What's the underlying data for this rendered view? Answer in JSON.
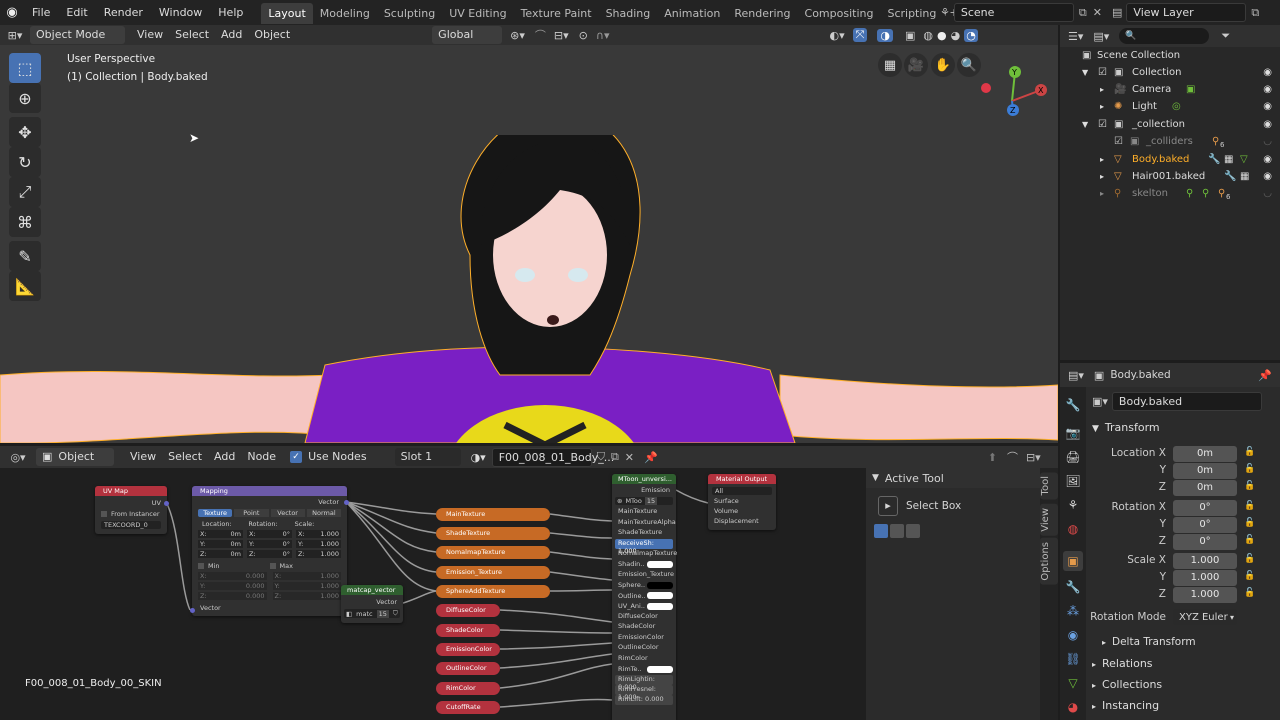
{
  "topbar": {
    "menus": [
      "File",
      "Edit",
      "Render",
      "Window",
      "Help"
    ],
    "workspaces": [
      "Layout",
      "Modeling",
      "Sculpting",
      "UV Editing",
      "Texture Paint",
      "Shading",
      "Animation",
      "Rendering",
      "Compositing",
      "Scripting"
    ],
    "active_workspace": "Layout",
    "scene": "Scene",
    "view_layer": "View Layer"
  },
  "viewport": {
    "mode": "Object Mode",
    "menus": [
      "View",
      "Select",
      "Add",
      "Object"
    ],
    "transform_orientation": "Global",
    "overlay_title": "User Perspective",
    "overlay_subtitle": "(1) Collection | Body.baked",
    "axes": {
      "x": "X",
      "y": "Y",
      "z": "Z"
    }
  },
  "node_editor": {
    "type": "Object",
    "menus": [
      "View",
      "Select",
      "Add",
      "Node"
    ],
    "use_nodes": "Use Nodes",
    "slot": "Slot 1",
    "material": "F00_008_01_Body_...",
    "material_label": "F00_008_01_Body_00_SKIN",
    "nodes": {
      "uvmap": {
        "title": "UV Map",
        "out": "UV",
        "from_instancer": "From Instancer",
        "uv_name": "TEXCOORD_0"
      },
      "mapping": {
        "title": "Mapping",
        "out": "Vector",
        "types": [
          "Texture",
          "Point",
          "Vector",
          "Normal"
        ],
        "location": "Location:",
        "rotation": "Rotation:",
        "scale": "Scale:",
        "loc": [
          "0m",
          "0m",
          "0m"
        ],
        "rot": [
          "0°",
          "0°",
          "0°"
        ],
        "scl": [
          "1.000",
          "1.000",
          "1.000"
        ],
        "min": "Min",
        "max": "Max",
        "min_vals": [
          "0.000",
          "0.000",
          "0.000"
        ],
        "max_vals": [
          "1.000",
          "1.000",
          "1.000"
        ],
        "in": "Vector",
        "x": "X:",
        "y": "Y:",
        "z": "Z:"
      },
      "matcap": {
        "title": "matcap_vector",
        "out": "Vector",
        "img": "matc",
        "users": "15"
      },
      "textures": [
        "MainTexture",
        "ShadeTexture",
        "NomalmapTexture",
        "Emission_Texture",
        "SphereAddTexture"
      ],
      "colors": [
        "DiffuseColor",
        "ShadeColor",
        "EmissionColor",
        "OutlineColor",
        "RimColor",
        "CutoffRate"
      ],
      "mtoon": {
        "title": "MToon_unversi...",
        "out": "Emission",
        "img": "MToo",
        "users": "15",
        "inputs": [
          "MainTexture",
          "MainTextureAlpha",
          "ShadeTexture",
          "ReceiveSh: 1.000",
          "NomalmapTexture",
          "Shadin..",
          "Emission_Texture",
          "Sphere..",
          "Outline..",
          "UV_Ani..",
          "DiffuseColor",
          "ShadeColor",
          "EmissionColor",
          "OutlineColor",
          "RimColor",
          "RimTe..",
          "RimLightin: 0.000",
          "RimFresnel: 1.000",
          "RimLift: 0.000"
        ]
      },
      "output": {
        "title": "Material Output",
        "target": "All",
        "inputs": [
          "Surface",
          "Volume",
          "Displacement"
        ]
      }
    },
    "sidebar": {
      "title": "Active Tool",
      "tool": "Select Box"
    },
    "tabs": [
      "Tool",
      "View",
      "Options"
    ]
  },
  "outliner": {
    "items": [
      {
        "label": "Scene Collection",
        "indent": 0
      },
      {
        "label": "Collection",
        "indent": 1
      },
      {
        "label": "Camera",
        "indent": 2
      },
      {
        "label": "Light",
        "indent": 2
      },
      {
        "label": "_collection",
        "indent": 1
      },
      {
        "label": "_colliders",
        "indent": 2
      },
      {
        "label": "Body.baked",
        "indent": 2
      },
      {
        "label": "Hair001.baked",
        "indent": 2
      },
      {
        "label": "skelton",
        "indent": 2
      }
    ],
    "badges": {
      "colliders": "6",
      "skelton": "6"
    }
  },
  "properties": {
    "object": "Body.baked",
    "name_field": "Body.baked",
    "transform": "Transform",
    "location_label": "Location X",
    "rotation_label": "Rotation X",
    "scale_label": "Scale X",
    "y": "Y",
    "z": "Z",
    "location": [
      "0m",
      "0m",
      "0m"
    ],
    "rotation": [
      "0°",
      "0°",
      "0°"
    ],
    "scale": [
      "1.000",
      "1.000",
      "1.000"
    ],
    "rotation_mode_label": "Rotation Mode",
    "rotation_mode": "XYZ Euler",
    "delta": "Delta Transform",
    "sections": [
      "Relations",
      "Collections",
      "Instancing"
    ]
  },
  "colors": {
    "accent": "#4772b3",
    "orange": "#c76a25",
    "red": "#b3323e",
    "selected": "#ffaf29"
  }
}
